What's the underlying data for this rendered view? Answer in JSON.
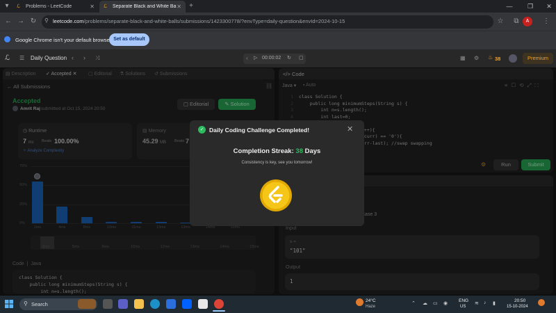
{
  "browser": {
    "tabs": [
      {
        "title": "Problems - LeetCode",
        "active": false
      },
      {
        "title": "Separate Black and White Balls",
        "active": true
      }
    ],
    "url_host": "leetcode.com",
    "url_path": "/problems/separate-black-and-white-balls/submissions/1423300778/?envType=daily-question&envId=2024-10-15",
    "profile_letter": "A",
    "infobar_message": "Google Chrome isn't your default browser",
    "set_default_label": "Set as default"
  },
  "lc_header": {
    "title": "Daily Question",
    "timer": "00:00:02",
    "streak_count": "38",
    "premium_label": "Premium"
  },
  "left_panel": {
    "tabs": [
      {
        "label": "Description"
      },
      {
        "label": "Accepted"
      },
      {
        "label": "Editorial"
      },
      {
        "label": "Solutions"
      },
      {
        "label": "Submissions"
      }
    ],
    "all_submissions": "All Submissions",
    "status": "Accepted",
    "author": "Amrit Raj",
    "submitted_at": "submitted at Oct 15, 2024 20:50",
    "editorial_btn": "Editorial",
    "solution_btn": "Solution",
    "runtime": {
      "label": "Runtime",
      "value": "7",
      "unit": "ms",
      "beats_label": "Beats",
      "beats": "100.00%",
      "analyze": "Analyze Complexity"
    },
    "memory": {
      "label": "Memory",
      "value": "45.29",
      "unit": "MB",
      "beats_label": "Beats",
      "beats": "7"
    },
    "code_tabs": {
      "label1": "Code",
      "label2": "Java"
    },
    "code_lines": [
      "class Solution {",
      "    public long minimumSteps(String s) {",
      "        int n=s.length();"
    ]
  },
  "chart_data": {
    "type": "bar",
    "categories": [
      "1ms",
      "4ms",
      "8ms",
      "13ms",
      "11ms",
      "13ms",
      "13ms",
      "14ms",
      "15ms"
    ],
    "values": [
      55,
      22,
      8,
      2,
      1.5,
      1.5,
      1,
      0.8,
      0.5
    ],
    "ylim": [
      0,
      75
    ],
    "yticks": [
      "75%",
      "50%",
      "25%",
      "0%"
    ],
    "mini_labels": [
      "2ms",
      "5ms",
      "8ms",
      "10ms",
      "12ms",
      "13ms",
      "14ms",
      "15ms"
    ],
    "grid": true
  },
  "right_panel": {
    "code_title": "Code",
    "lang": "Java",
    "auto": "Auto",
    "line_numbers": [
      "1",
      "2",
      "3",
      "4",
      "5",
      "6",
      "7",
      "8"
    ],
    "code_lines": [
      "class Solution {",
      "    public long minimumSteps(String s) {",
      "        int n=s.length();",
      "        int last=0;",
      "",
      "        for(...;i<n;curr++){",
      "            if(s.charAt(curr) == '0'){",
      "                ans+=(curr-last); //swap swapping"
    ],
    "run_btn": "Run",
    "submit_btn": "Submit",
    "case_label": "Case 3",
    "input_label": "Input",
    "input_var": "s =",
    "input_value": "\"101\"",
    "output_label": "Output",
    "output_value": "1"
  },
  "modal": {
    "title": "Daily Coding Challenge Completed!",
    "streak_prefix": "Completion Streak: ",
    "streak_value": "38",
    "streak_suffix": " Days",
    "subtitle": "Consistency is key, see you tomorrow!",
    "accent": "#2cbb5d",
    "coin_color": "#f5c518"
  },
  "taskbar": {
    "search": "Search",
    "weather_temp": "24°C",
    "weather_desc": "Haze",
    "lang1": "ENG",
    "lang2": "US",
    "time": "20:50",
    "date": "15-10-2024"
  }
}
